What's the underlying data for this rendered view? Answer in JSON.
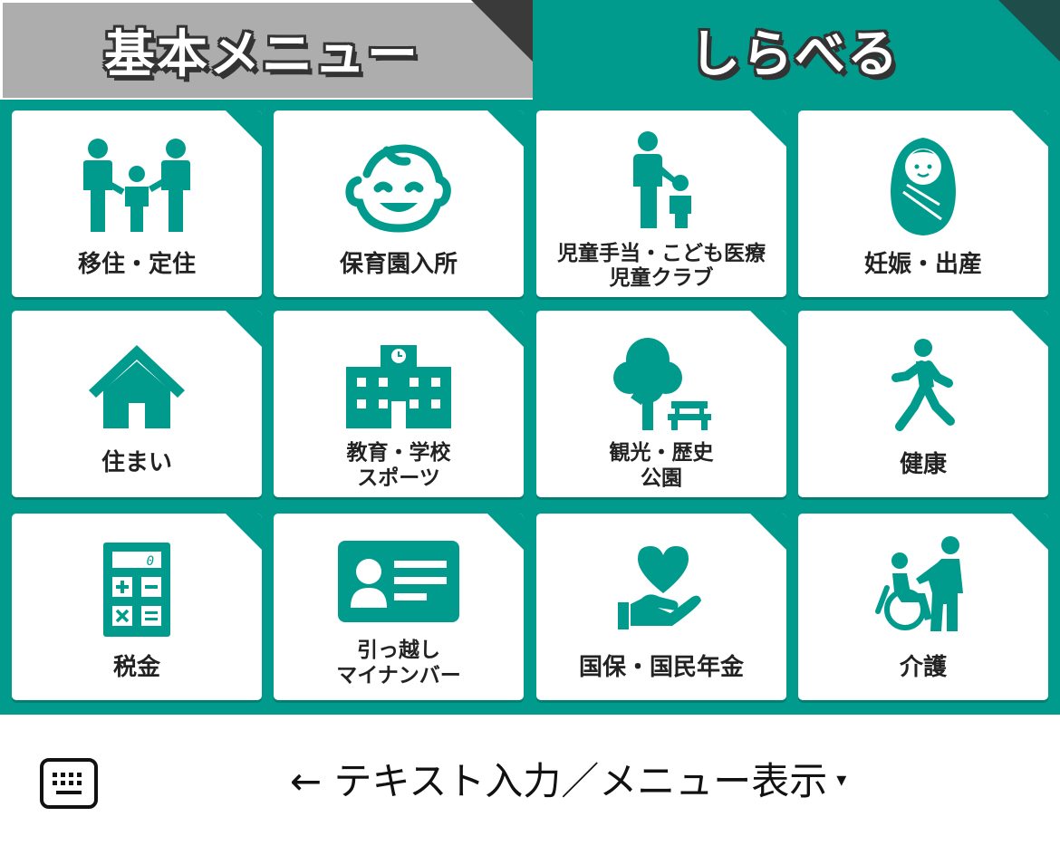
{
  "tabs": {
    "basic_menu": "基本メニュー",
    "search": "しらべる"
  },
  "menu": {
    "items": [
      {
        "label": "移住・定住",
        "icon": "family-icon"
      },
      {
        "label": "保育園入所",
        "icon": "baby-face-icon"
      },
      {
        "label": "児童手当・こども医療",
        "label2": "児童クラブ",
        "icon": "parent-child-icon"
      },
      {
        "label": "妊娠・出産",
        "icon": "swaddled-baby-icon"
      },
      {
        "label": "住まい",
        "icon": "house-icon"
      },
      {
        "label": "教育・学校",
        "label2": "スポーツ",
        "icon": "school-building-icon"
      },
      {
        "label": "観光・歴史",
        "label2": "公園",
        "icon": "tree-bench-icon"
      },
      {
        "label": "健康",
        "icon": "walking-person-icon"
      },
      {
        "label": "税金",
        "icon": "calculator-icon"
      },
      {
        "label": "引っ越し",
        "label2": "マイナンバー",
        "icon": "id-card-icon"
      },
      {
        "label": "国保・国民年金",
        "icon": "heart-hand-icon"
      },
      {
        "label": "介護",
        "icon": "wheelchair-care-icon"
      }
    ]
  },
  "calculator_display": "0",
  "bottom_bar": {
    "toggle_label": "← テキスト入力／メニュー表示",
    "toggle_arrow": "▾"
  },
  "colors": {
    "accent": "#009b8c",
    "inactive_tab": "#adadad",
    "corner_dark": "#333333"
  }
}
